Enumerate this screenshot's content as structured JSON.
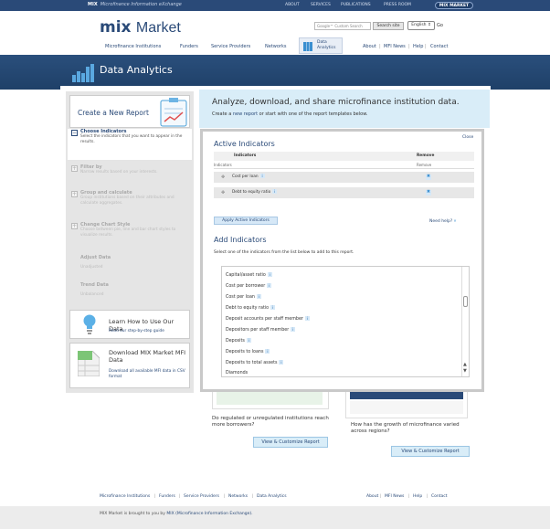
{
  "topbar": {
    "brand": "MIX",
    "tagline": "Microfinance Information eXchange",
    "links": [
      "ABOUT",
      "SERVICES",
      "PUBLICATIONS",
      "PRESS ROOM"
    ],
    "mix_market": "MIX MARKET"
  },
  "header": {
    "logo_mix": "mix",
    "logo_market": "Market",
    "search_placeholder": "Google™ Custom Search",
    "search_button": "Search site",
    "language": "English",
    "go": "Go"
  },
  "nav": {
    "items": [
      "Microfinance Institutions",
      "Funders",
      "Service Providers",
      "Networks"
    ],
    "active_line1": "Data",
    "active_line2": "Analytics",
    "right": [
      "About",
      "MFI News",
      "Help",
      "Contact"
    ]
  },
  "banner": {
    "title": "Data Analytics"
  },
  "sidebar": {
    "create": "Create a New Report",
    "steps": [
      {
        "title": "Choose Indicators",
        "desc": "Select the indicators that you want to appear in the results."
      },
      {
        "title": "Filter by",
        "desc": "Narrow results based on your interests."
      },
      {
        "title": "Group and calculate",
        "desc": "Group institutions based on their attributes and calculate aggregates."
      },
      {
        "title": "Change Chart Style",
        "desc": "Choose between pie, line and bar chart styles to visualize results."
      }
    ],
    "adjust": {
      "title": "Adjust Data",
      "sub": "Unadjusted"
    },
    "trend": {
      "title": "Trend Data",
      "sub": "Unbalanced"
    },
    "learn": {
      "title": "Learn How to Use Our Data",
      "link": "Read our step-by-step guide"
    },
    "download": {
      "title": "Download MIX Market MFI Data",
      "link": "Download all available MFI data in CSV format"
    }
  },
  "hero": {
    "title": "Analyze, download, and share microfinance institution data.",
    "sub_prefix": "Create a ",
    "sub_link": "new report",
    "sub_suffix": " or start with one of the report templates below."
  },
  "active_indicators": {
    "close": "Close",
    "title": "Active Indicators",
    "col_indicators": "Indicators",
    "col_remove": "Remove",
    "sub_indicators": "Indicators",
    "sub_remove": "Remove",
    "rows": [
      "Cost per loan",
      "Debt to equity ratio"
    ],
    "apply": "Apply Active Indicators",
    "need_help": "Need help?"
  },
  "add_indicators": {
    "title": "Add Indicators",
    "instruction": "Select one of the indicators from the list below to add to this report.",
    "items": [
      {
        "label": "Capital/asset ratio",
        "info": true
      },
      {
        "label": "Cost per borrower",
        "info": true
      },
      {
        "label": "Cost per loan",
        "info": true
      },
      {
        "label": "Debt to equity ratio",
        "info": true
      },
      {
        "label": "Deposit accounts per staff member",
        "info": true
      },
      {
        "label": "Depositors per staff member",
        "info": true
      },
      {
        "label": "Deposits",
        "info": true
      },
      {
        "label": "Deposits to loans",
        "info": true
      },
      {
        "label": "Deposits to total assets",
        "info": true
      },
      {
        "label": "Diamonds",
        "info": false
      }
    ]
  },
  "templates": [
    {
      "question": "Do regulated or unregulated institutions reach more borrowers?",
      "button": "View & Customize Report"
    },
    {
      "question": "How has the growth of microfinance varied across regions?",
      "button": "View & Customize Report"
    }
  ],
  "footer": {
    "links": [
      "Microfinance Institutions",
      "Funders",
      "Service Providers",
      "Networks",
      "Data Analytics"
    ],
    "right": [
      "About",
      "MFI News",
      "Help",
      "Contact"
    ],
    "credit_prefix": "MIX Market is brought to you by ",
    "credit_link": "MIX (Microfinance Information Exchange)."
  },
  "colors": {
    "navy": "#2a4a78",
    "banner": "#1f4068",
    "light_blue": "#d9edf8",
    "accent": "#3a8fd0"
  }
}
